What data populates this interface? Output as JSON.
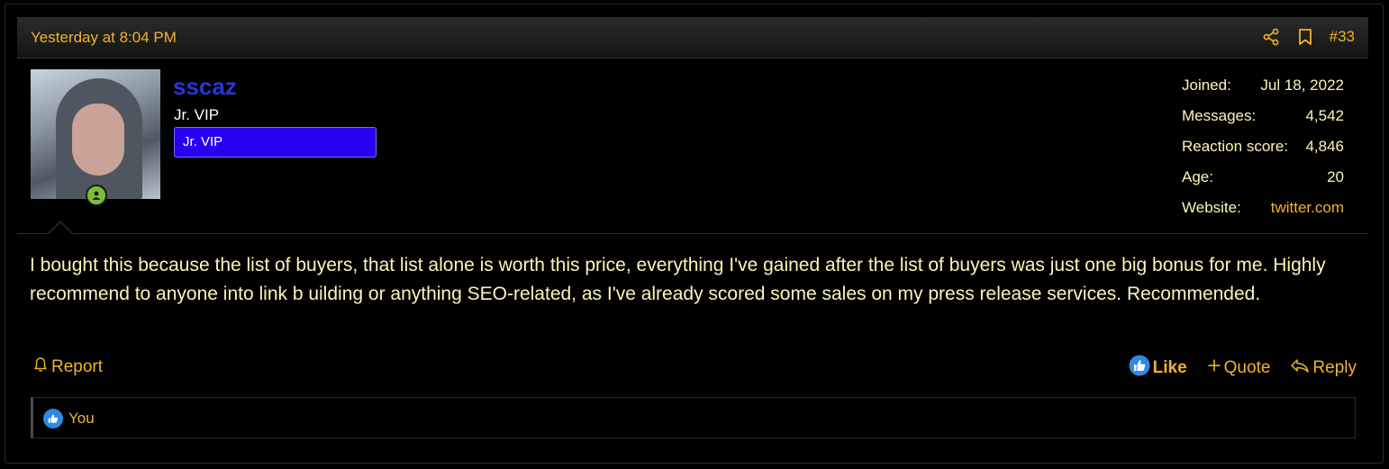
{
  "post": {
    "date": "Yesterday at 8:04 PM",
    "number": "#33",
    "body": "I bought this because the list of buyers, that list alone is worth this price, everything I've gained after the list of buyers was just one big bonus for me. Highly recommend to anyone into link b uilding or anything SEO-related, as I've already scored some sales on my press release services. Recommended."
  },
  "user": {
    "name": "sscaz",
    "title": "Jr. VIP",
    "banner": "Jr. VIP",
    "status": "online"
  },
  "stats": [
    {
      "label": "Joined:",
      "value": "Jul 18, 2022"
    },
    {
      "label": "Messages:",
      "value": "4,542"
    },
    {
      "label": "Reaction score:",
      "value": "4,846"
    },
    {
      "label": "Age:",
      "value": "20"
    },
    {
      "label": "Website:",
      "value": "twitter.com"
    }
  ],
  "actions": {
    "report": "Report",
    "like": "Like",
    "quote": "Quote",
    "reply": "Reply"
  },
  "reactions": {
    "summary": "You"
  },
  "icons": {
    "share": "share-icon",
    "bookmark": "bookmark-icon",
    "report": "bell-icon",
    "like": "thumbs-up-icon",
    "quote": "plus-icon",
    "reply": "reply-arrow-icon",
    "online": "user-online-icon"
  },
  "colors": {
    "accent": "#f0b429",
    "username": "#2a35d6",
    "banner": "#2a00f0",
    "text": "#fbf5b7",
    "like_badge": "#2d88e6",
    "online": "#7cbd3b"
  }
}
